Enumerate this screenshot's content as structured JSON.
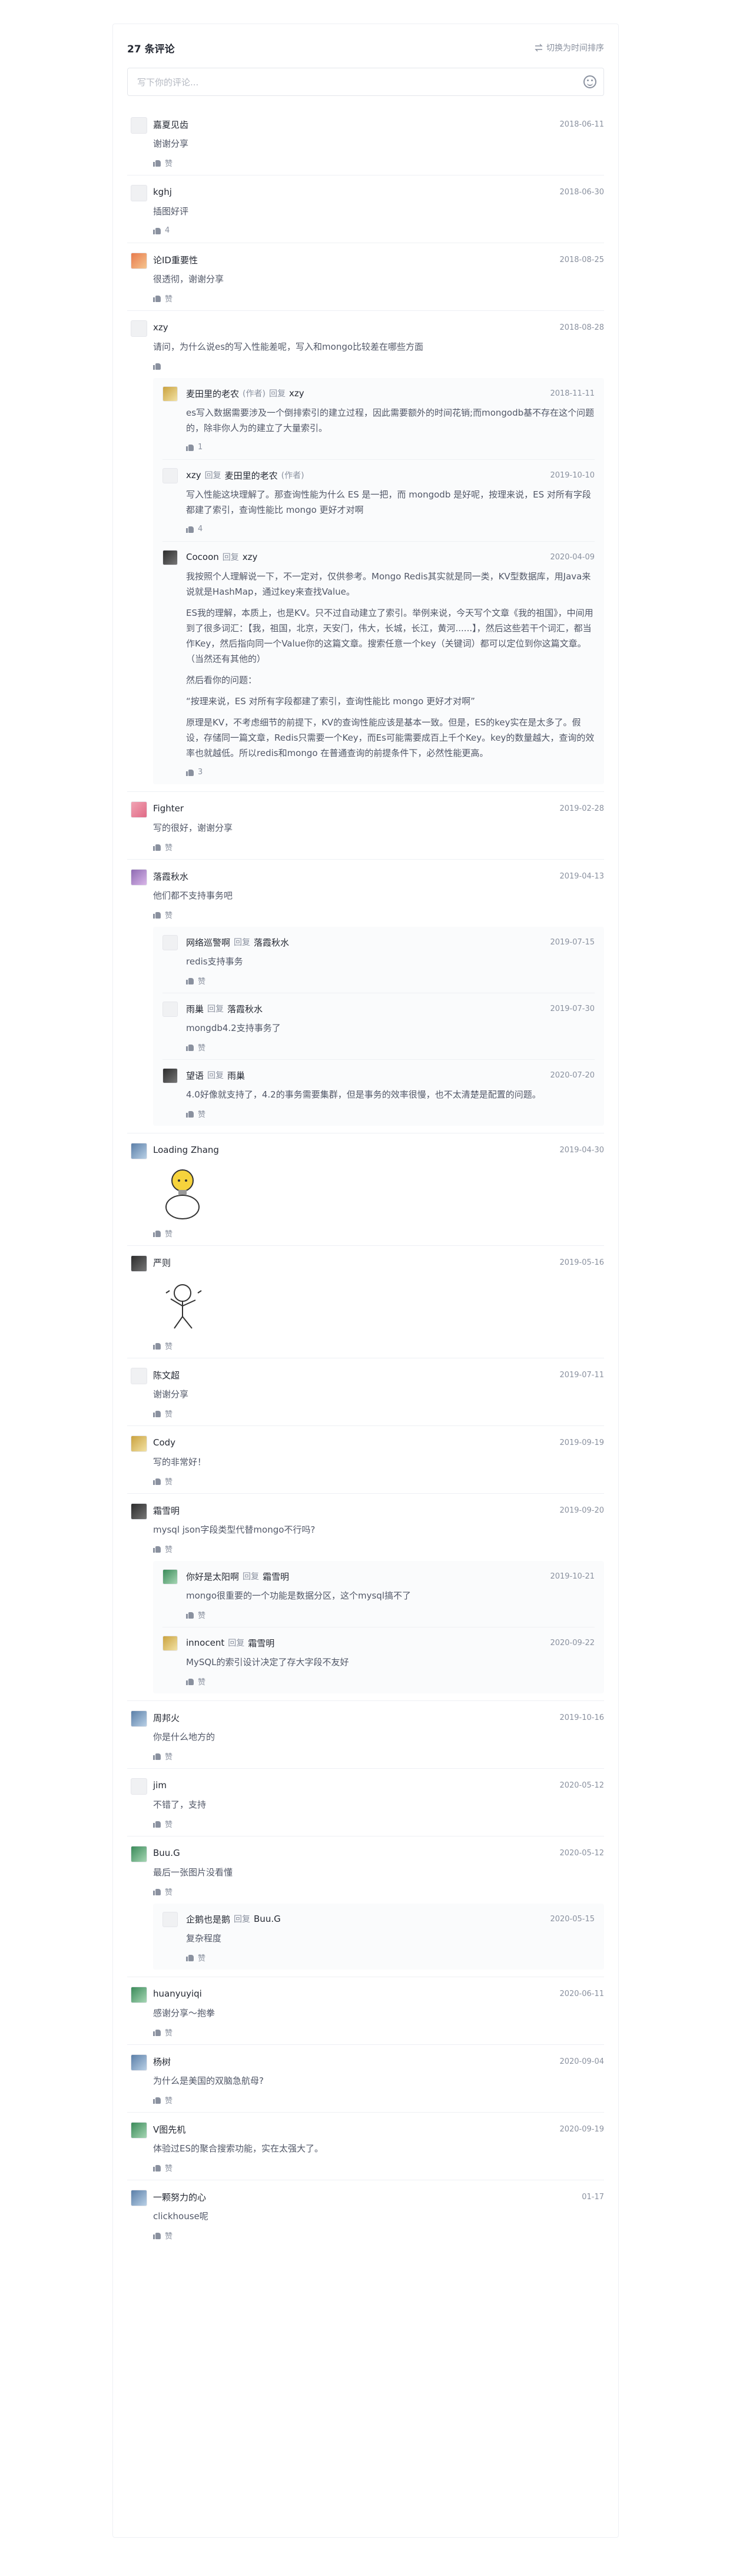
{
  "header": {
    "count_label": "27 条评论",
    "sort_label": "切换为时间排序"
  },
  "input": {
    "placeholder": "写下你的评论..."
  },
  "comments": [
    {
      "user": "嘉夏见齿",
      "time": "2018-06-11",
      "text": "谢谢分享",
      "likes": "赞",
      "avatar": "av-gray"
    },
    {
      "user": "kghj",
      "time": "2018-06-30",
      "text": "插图好评",
      "likes": "4",
      "avatar": "av-gray"
    },
    {
      "user": "论ID重要性",
      "time": "2018-08-25",
      "text": "很透彻，谢谢分享",
      "likes": "赞",
      "avatar": "av-orange"
    },
    {
      "user": "xzy",
      "time": "2018-08-28",
      "text": "请问，为什么说es的写入性能差呢，写入和mongo比较差在哪些方面",
      "likes": "",
      "avatar": "av-gray",
      "replies": [
        {
          "user": "麦田里的老农",
          "tag": "(作者)",
          "reply_word": "回复",
          "target": "xzy",
          "time": "2018-11-11",
          "text": "es写入数据需要涉及一个倒排索引的建立过程，因此需要额外的时间花销;而mongodb基不存在这个问题的，除非你人为的建立了大量索引。",
          "likes": "1",
          "avatar": "av-yellow"
        },
        {
          "user": "xzy",
          "reply_word": "回复",
          "target": "麦田里的老农",
          "target_tag": "(作者)",
          "time": "2019-10-10",
          "text": "写入性能这块理解了。那查询性能为什么 ES 是一把，而 mongodb 是好呢，按理来说，ES 对所有字段都建了索引，查询性能比 mongo 更好才对啊",
          "likes": "4",
          "avatar": "av-gray"
        },
        {
          "user": "Cocoon",
          "reply_word": "回复",
          "target": "xzy",
          "time": "2020-04-09",
          "paragraphs": [
            "我按照个人理解说一下，不一定对，仅供参考。Mongo Redis其实就是同一类，KV型数据库，用Java来说就是HashMap，通过key来查找Value。",
            "ES我的理解，本质上，也是KV。只不过自动建立了索引。举例来说，今天写个文章《我的祖国》，中间用到了很多词汇：【我，祖国，北京，天安门，伟大，长城，长江，黄河......】，然后这些若干个词汇，都当作Key，然后指向同一个Value你的这篇文章。搜索任意一个key（关键词）都可以定位到你这篇文章。（当然还有其他的）",
            "",
            "然后看你的问题：",
            "“按理来说，ES 对所有字段都建了索引，查询性能比 mongo 更好才对啊”",
            "原理是KV，不考虑细节的前提下，KV的查询性能应该是基本一致。但是，ES的key实在是太多了。假设，存储同一篇文章，Redis只需要一个Key，而Es可能需要成百上千个Key。key的数量越大，查询的效率也就越低。所以redis和mongo 在普通查询的前提条件下，必然性能更高。"
          ],
          "likes": "3",
          "avatar": "av-dark"
        }
      ]
    },
    {
      "user": "Fighter",
      "time": "2019-02-28",
      "text": "写的很好，谢谢分享",
      "likes": "赞",
      "avatar": "av-pink"
    },
    {
      "user": "落霞秋水",
      "time": "2019-04-13",
      "text": "他们都不支持事务吧",
      "likes": "赞",
      "avatar": "av-purple",
      "replies": [
        {
          "user": "网络巡警啊",
          "reply_word": "回复",
          "target": "落霞秋水",
          "time": "2019-07-15",
          "text": "redis支持事务",
          "likes": "赞",
          "avatar": "av-gray"
        },
        {
          "user": "雨巢",
          "reply_word": "回复",
          "target": "落霞秋水",
          "time": "2019-07-30",
          "text": "mongdb4.2支持事务了",
          "likes": "赞",
          "avatar": "av-gray"
        },
        {
          "user": "望语",
          "reply_word": "回复",
          "target": "雨巢",
          "time": "2020-07-20",
          "text": "4.0好像就支持了，4.2的事务需要集群，但是事务的效率很慢，也不太清楚是配置的问题。",
          "likes": "赞",
          "avatar": "av-dark"
        }
      ]
    },
    {
      "user": "Loading Zhang",
      "time": "2019-04-30",
      "text": "",
      "sticker": "bulb",
      "likes": "赞",
      "avatar": "av-blue"
    },
    {
      "user": "严则",
      "time": "2019-05-16",
      "text": "",
      "sticker": "dance",
      "likes": "赞",
      "avatar": "av-dark"
    },
    {
      "user": "陈文超",
      "time": "2019-07-11",
      "text": "谢谢分享",
      "likes": "赞",
      "avatar": "av-gray"
    },
    {
      "user": "Cody",
      "time": "2019-09-19",
      "text": "写的非常好！",
      "likes": "赞",
      "avatar": "av-yellow"
    },
    {
      "user": "霜雪明",
      "time": "2019-09-20",
      "text": "mysql json字段类型代替mongo不行吗?",
      "likes": "赞",
      "avatar": "av-dark",
      "replies": [
        {
          "user": "你好是太阳啊",
          "reply_word": "回复",
          "target": "霜雪明",
          "time": "2019-10-21",
          "text": "mongo很重要的一个功能是数据分区，这个mysql搞不了",
          "likes": "赞",
          "avatar": "av-green"
        },
        {
          "user": "innocent",
          "reply_word": "回复",
          "target": "霜雪明",
          "time": "2020-09-22",
          "text": "MySQL的索引设计决定了存大字段不友好",
          "likes": "赞",
          "avatar": "av-yellow"
        }
      ]
    },
    {
      "user": "周邦火",
      "time": "2019-10-16",
      "text": "你是什么地方的",
      "likes": "赞",
      "avatar": "av-blue"
    },
    {
      "user": "jim",
      "time": "2020-05-12",
      "text": "不错了，支持",
      "likes": "赞",
      "avatar": "av-gray"
    },
    {
      "user": "Buu.G",
      "time": "2020-05-12",
      "text": "最后一张图片没看懂",
      "likes": "赞",
      "avatar": "av-green",
      "replies": [
        {
          "user": "企鹅也是鹅",
          "reply_word": "回复",
          "target": "Buu.G",
          "time": "2020-05-15",
          "text": "复杂程度",
          "likes": "赞",
          "avatar": "av-gray"
        }
      ]
    },
    {
      "user": "huanyuyiqi",
      "time": "2020-06-11",
      "text": "感谢分享～抱拳",
      "likes": "赞",
      "avatar": "av-green"
    },
    {
      "user": "杨树",
      "time": "2020-09-04",
      "text": "为什么是美国的双脑急航母?",
      "likes": "赞",
      "avatar": "av-blue"
    },
    {
      "user": "V图先机",
      "time": "2020-09-19",
      "text": "体验过ES的聚合搜索功能，实在太强大了。",
      "likes": "赞",
      "avatar": "av-green"
    },
    {
      "user": "一颗努力的心",
      "time": "01-17",
      "text": "clickhouse呢",
      "likes": "赞",
      "avatar": "av-blue"
    }
  ]
}
